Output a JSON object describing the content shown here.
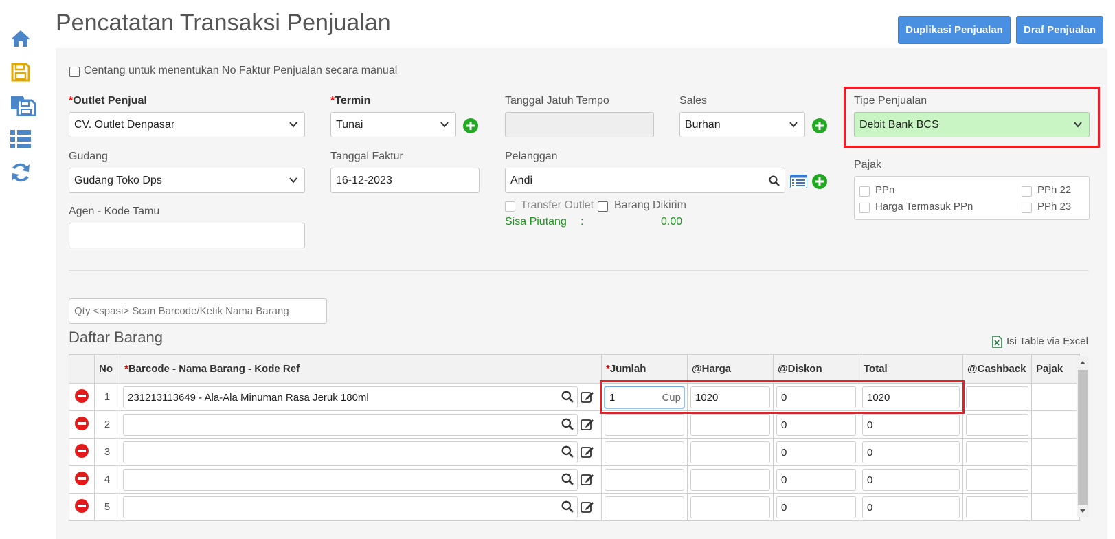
{
  "page": {
    "title": "Pencatatan Transaksi Penjualan"
  },
  "actions": {
    "duplicate": "Duplikasi Penjualan",
    "draft": "Draf Penjualan"
  },
  "sidebar": {
    "icons": [
      "home-icon",
      "save-icon",
      "save-all-icon",
      "list-icon",
      "refresh-icon"
    ]
  },
  "form": {
    "manual_invoice_label": "Centang untuk menentukan No Faktur Penjualan secara manual",
    "outlet": {
      "label": "Outlet Penjual",
      "required_mark": "*",
      "value": "CV. Outlet Denpasar"
    },
    "termin": {
      "label": "Termin",
      "required_mark": "*",
      "value": "Tunai"
    },
    "due_date": {
      "label": "Tanggal Jatuh Tempo",
      "value": ""
    },
    "sales": {
      "label": "Sales",
      "value": "Burhan"
    },
    "sale_type": {
      "label": "Tipe Penjualan",
      "value": "Debit Bank BCS"
    },
    "warehouse": {
      "label": "Gudang",
      "value": "Gudang Toko Dps"
    },
    "invoice_date": {
      "label": "Tanggal Faktur",
      "value": "16-12-2023"
    },
    "customer": {
      "label": "Pelanggan",
      "value": "Andi"
    },
    "agent": {
      "label": "Agen - Kode Tamu",
      "value": ""
    },
    "transfer_outlet": "Transfer Outlet",
    "goods_sent": "Barang Dikirim",
    "receivable": {
      "label": "Sisa Piutang",
      "separator": ":",
      "value": "0.00"
    },
    "tax": {
      "label": "Pajak",
      "ppn": "PPn",
      "price_incl_ppn": "Harga Termasuk PPn",
      "pph22": "PPh 22",
      "pph23": "PPh 23"
    }
  },
  "scan": {
    "placeholder": "Qty <spasi> Scan Barcode/Ketik Nama Barang"
  },
  "items": {
    "title": "Daftar Barang",
    "excel_label": "Isi Table via Excel",
    "columns": {
      "no": "No",
      "req": "*",
      "barcode": "Barcode - Nama Barang - Kode Ref",
      "qty": "Jumlah",
      "price": "@Harga",
      "discount": "@Diskon",
      "total": "Total",
      "cashback": "@Cashback",
      "tax": "Pajak"
    },
    "rows": [
      {
        "no": "1",
        "item": "231213113649 - Ala-Ala Minuman Rasa Jeruk 180ml",
        "qty": "1",
        "unit": "Cup",
        "price": "1020",
        "discount": "0",
        "total": "1020",
        "cashback": ""
      },
      {
        "no": "2",
        "item": "",
        "qty": "",
        "unit": "",
        "price": "",
        "discount": "0",
        "total": "0",
        "cashback": ""
      },
      {
        "no": "3",
        "item": "",
        "qty": "",
        "unit": "",
        "price": "",
        "discount": "0",
        "total": "0",
        "cashback": ""
      },
      {
        "no": "4",
        "item": "",
        "qty": "",
        "unit": "",
        "price": "",
        "discount": "0",
        "total": "0",
        "cashback": ""
      },
      {
        "no": "5",
        "item": "",
        "qty": "",
        "unit": "",
        "price": "",
        "discount": "0",
        "total": "0",
        "cashback": ""
      }
    ]
  },
  "colors": {
    "accent": "#4a90e2",
    "highlight": "#ee1c25",
    "success": "#1a9a1a",
    "sale_type_bg": "#c8f5c3",
    "remove": "#e41b1b"
  }
}
